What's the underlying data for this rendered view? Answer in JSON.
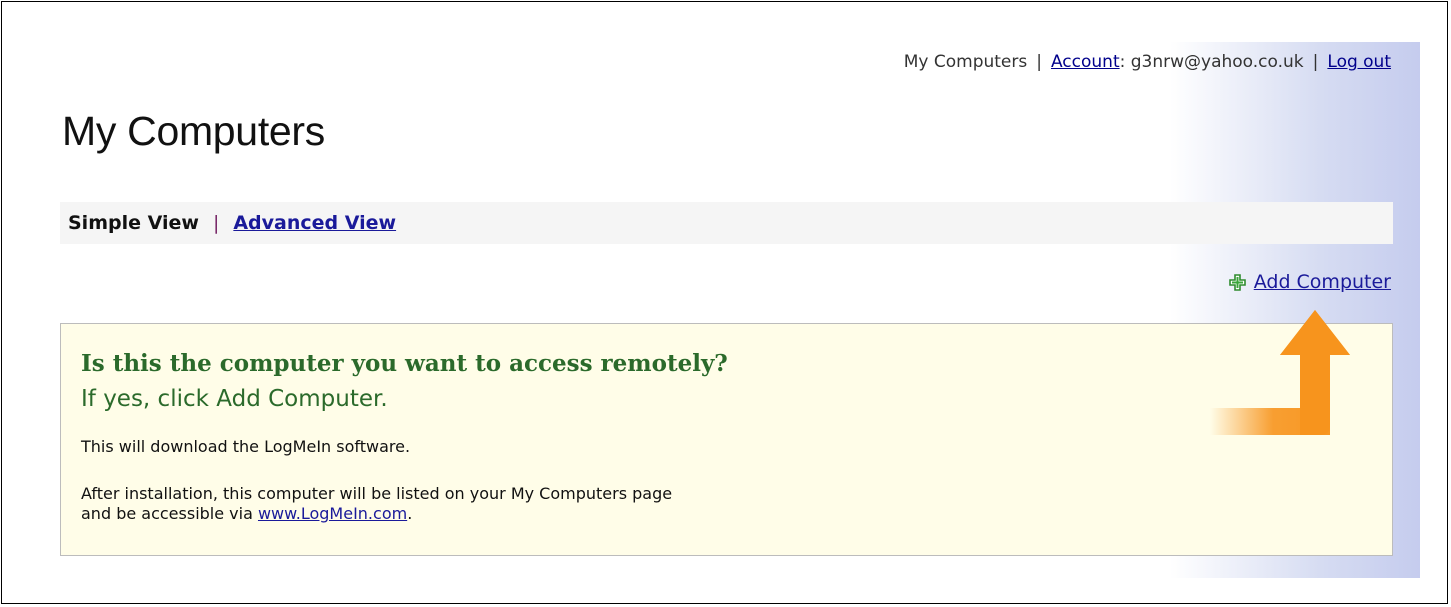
{
  "topnav": {
    "my_computers": "My Computers",
    "account_label": "Account",
    "account_suffix": ": g3nrw@yahoo.co.uk",
    "logout": "Log out",
    "separator": "|"
  },
  "page": {
    "title": "My Computers"
  },
  "views": {
    "simple": "Simple View",
    "separator": "|",
    "advanced": "Advanced View"
  },
  "actions": {
    "add_computer": "Add Computer"
  },
  "panel": {
    "question": "Is this the computer you want to access remotely?",
    "instruction": "If yes, click Add Computer.",
    "download_note": "This will download the LogMeIn software.",
    "install_line1": "After installation, this computer will be listed on your My Computers page",
    "install_line2_prefix": "and be accessible via ",
    "site_link": "www.LogMeIn.com",
    "install_line2_suffix": "."
  },
  "icons": {
    "add": "plus-icon",
    "pointer": "arrow-up-icon"
  },
  "colors": {
    "link": "#1a1a9a",
    "heading_green": "#2b6a2b",
    "panel_bg": "#fffde8",
    "arrow_orange": "#f7941d"
  }
}
